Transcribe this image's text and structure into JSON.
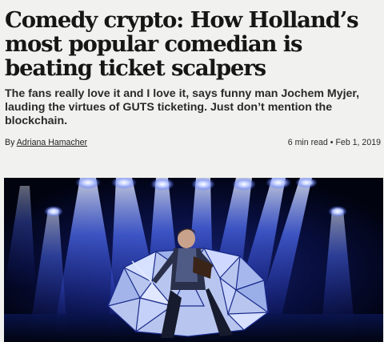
{
  "article": {
    "headline": "Comedy crypto: How Holland’s most popular comedian is beating ticket scalpers",
    "subheadline": "The fans really love it and I love it, says funny man Jochem Myjer, lauding the virtues of GUTS ticketing. Just don’t mention the blockchain.",
    "byline_prefix": "By",
    "author": "Adriana Hamacher",
    "read_time": "6 min read",
    "separator": "•",
    "date": "Feb 1, 2019"
  },
  "hero_image": {
    "subject": "comedian-on-stage-with-spotlights",
    "colors": {
      "background": "#020513",
      "spotlight": "#3d5bff",
      "spotlight_core": "#cfd9ff"
    }
  }
}
